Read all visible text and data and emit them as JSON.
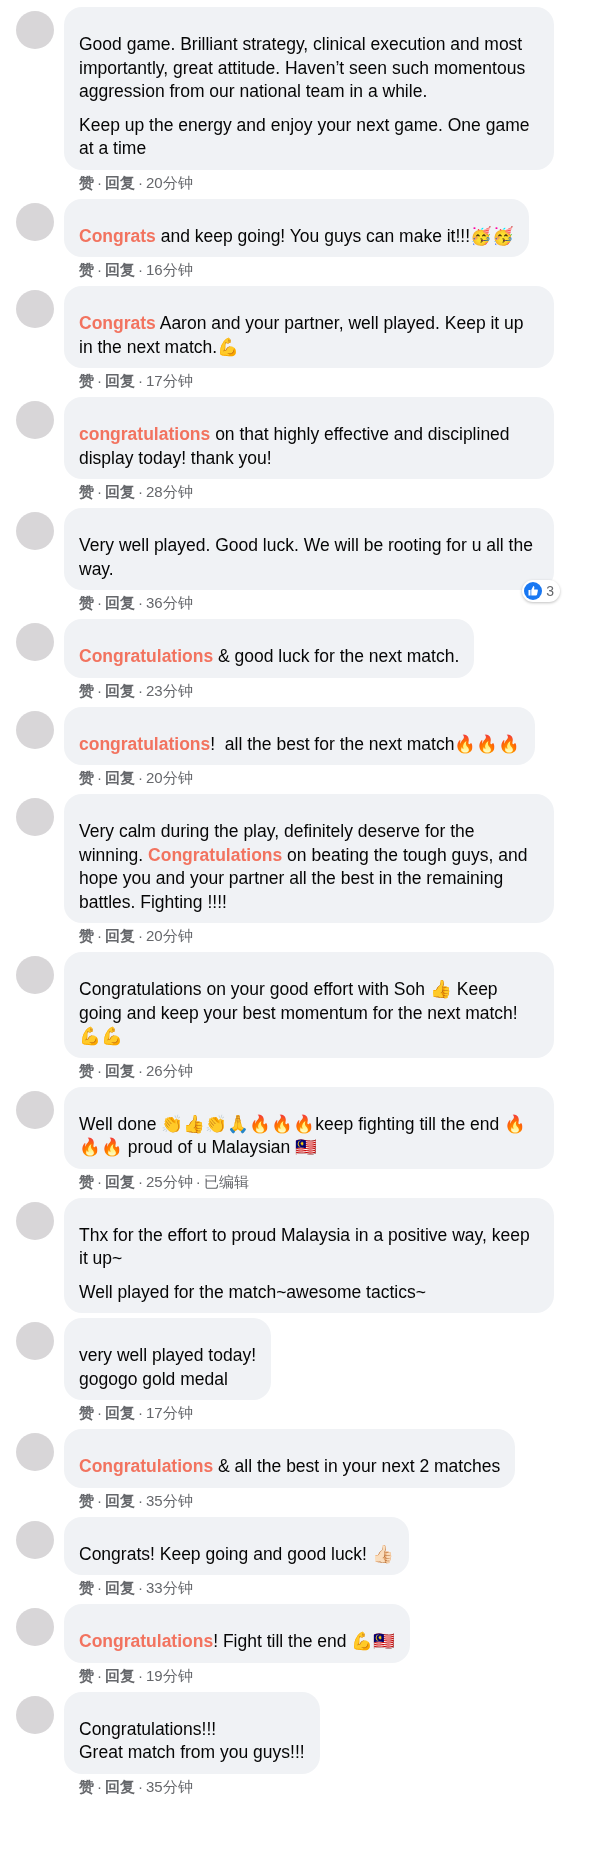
{
  "separator": "·",
  "comments": [
    {
      "paragraphs": [
        "Good game. Brilliant strategy, clinical execution and most importantly, great attitude. Haven’t seen such momentous aggression from our national team in a while.",
        "Keep up the energy and enjoy your next game. One game at a time"
      ],
      "actions": [
        "赞",
        "回复"
      ],
      "time": "20分钟"
    },
    {
      "paragraphs": [
        "**Congrats** and keep going! You guys can make it!!!🥳🥳"
      ],
      "actions": [
        "赞",
        "回复"
      ],
      "time": "16分钟"
    },
    {
      "paragraphs": [
        "**Congrats** Aaron and your partner, well played. Keep it up in the next match.💪"
      ],
      "actions": [
        "赞",
        "回复"
      ],
      "time": "17分钟"
    },
    {
      "paragraphs": [
        "**congratulations** on that highly effective and disciplined display today! thank you!"
      ],
      "actions": [
        "赞",
        "回复"
      ],
      "time": "28分钟"
    },
    {
      "paragraphs": [
        "Very well played. Good luck. We will be rooting for u all the way."
      ],
      "actions": [
        "赞",
        "回复"
      ],
      "time": "36分钟",
      "reactions": "3"
    },
    {
      "paragraphs": [
        "**Congratulations** & good luck for the next match."
      ],
      "actions": [
        "赞",
        "回复"
      ],
      "time": "23分钟"
    },
    {
      "paragraphs": [
        "**congratulations**!  all the best for the next match🔥🔥🔥"
      ],
      "actions": [
        "赞",
        "回复"
      ],
      "time": "20分钟"
    },
    {
      "paragraphs": [
        "Very calm during the play, definitely deserve for the winning. **Congratulations** on beating the tough guys, and hope you and your partner all the best in the remaining battles. Fighting !!!!"
      ],
      "actions": [
        "赞",
        "回复"
      ],
      "time": "20分钟"
    },
    {
      "paragraphs": [
        "Congratulations on your good effort with Soh 👍 Keep going and keep your best momentum for the next match! 💪💪"
      ],
      "actions": [
        "赞",
        "回复"
      ],
      "time": "26分钟"
    },
    {
      "paragraphs": [
        "Well done 👏👍👏🙏🔥🔥🔥keep fighting till the end 🔥🔥🔥 proud of u Malaysian 🇲🇾"
      ],
      "actions": [
        "赞",
        "回复"
      ],
      "time": "25分钟",
      "edited": "已编辑"
    },
    {
      "paragraphs": [
        "Thx for the effort to proud Malaysia in a positive way, keep it up~",
        "Well played for the match~awesome tactics~"
      ]
    },
    {
      "paragraphs": [
        "very well played today!\ngogogo gold medal"
      ],
      "actions": [
        "赞",
        "回复"
      ],
      "time": "17分钟"
    },
    {
      "paragraphs": [
        "**Congratulations** & all the best in your next 2 matches"
      ],
      "actions": [
        "赞",
        "回复"
      ],
      "time": "35分钟"
    },
    {
      "paragraphs": [
        "Congrats! Keep going and good luck! 👍🏻"
      ],
      "actions": [
        "赞",
        "回复"
      ],
      "time": "33分钟"
    },
    {
      "paragraphs": [
        "**Congratulations**! Fight till the end 💪🇲🇾"
      ],
      "actions": [
        "赞",
        "回复"
      ],
      "time": "19分钟"
    },
    {
      "paragraphs": [
        "Congratulations!!!\nGreat match from you guys!!!"
      ],
      "actions": [
        "赞",
        "回复"
      ],
      "time": "35分钟"
    }
  ]
}
